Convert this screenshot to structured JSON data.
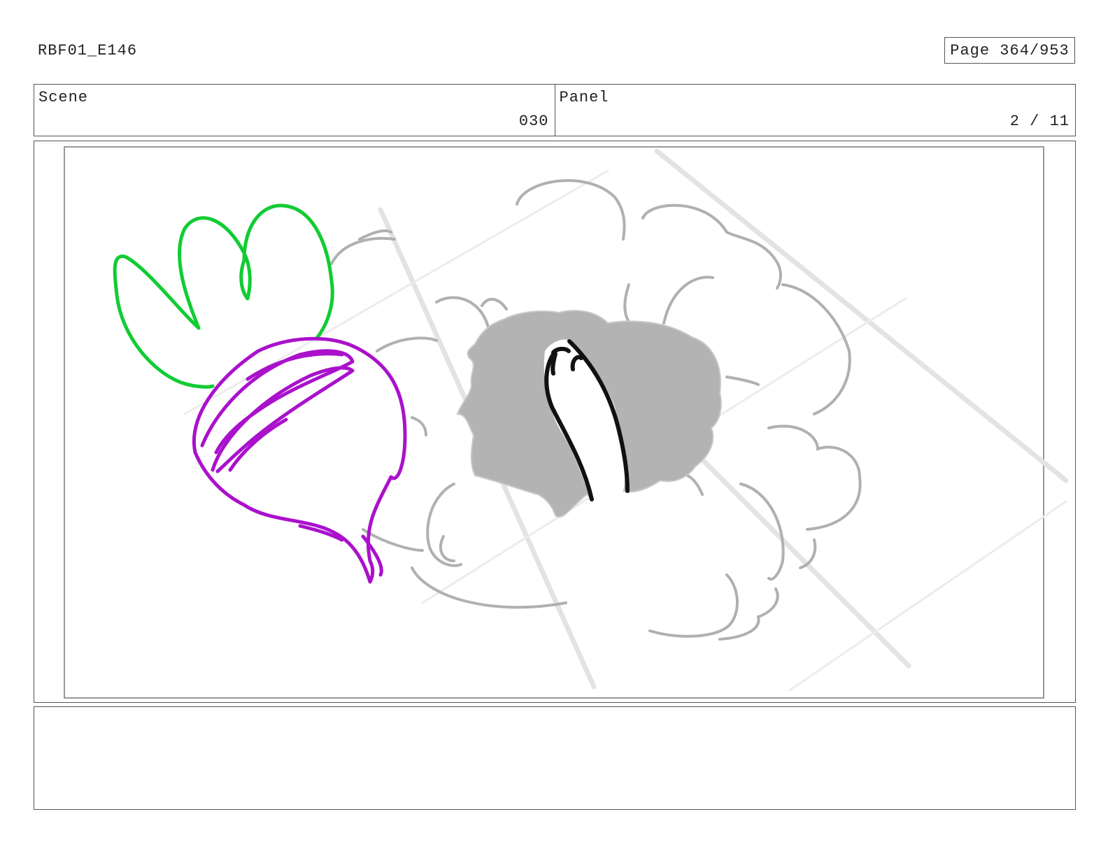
{
  "header": {
    "document_id": "RBF01_E146",
    "page_label": "Page 364/953"
  },
  "info": {
    "scene_label": "Scene",
    "scene_value": "030",
    "panel_label": "Panel",
    "panel_value": "2 / 11"
  },
  "drawing": {
    "description_colors": {
      "leaf": "#11cc33",
      "radish": "#aa11cc",
      "cloud": "#b0b0b0",
      "hole": "#b3b3b3",
      "grid": "#e2e2e2"
    }
  },
  "notes": {
    "text": ""
  }
}
